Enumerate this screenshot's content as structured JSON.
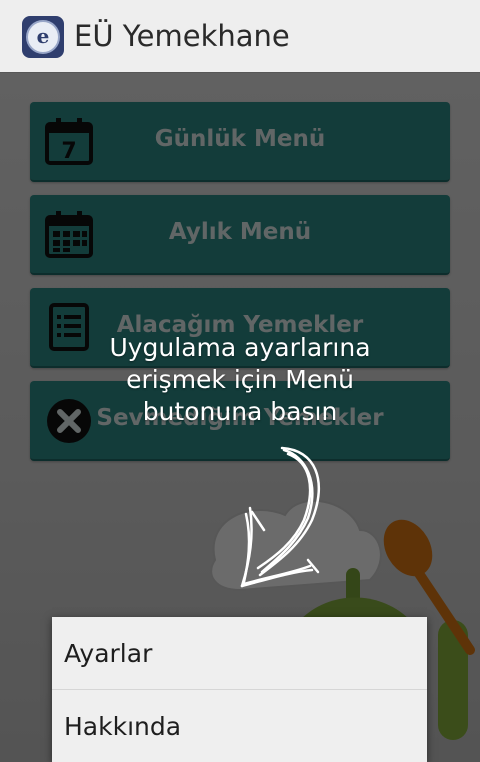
{
  "app": {
    "title": "EÜ Yemekhane",
    "logo_letter": "e"
  },
  "menu_buttons": [
    {
      "label": "Günlük Menü",
      "icon": "calendar-day-icon",
      "day": "7"
    },
    {
      "label": "Aylık Menü",
      "icon": "calendar-month-icon"
    },
    {
      "label": "Alacağım Yemekler",
      "icon": "list-icon"
    },
    {
      "label": "Sevmediğim Yemekler",
      "icon": "close-circle-icon"
    }
  ],
  "hint": {
    "lines": [
      "Uygulama ayarlarına",
      "erişmek için Menü",
      "butonuna basın"
    ],
    "arrow_icon": "hand-drawn-arrow-icon"
  },
  "options_menu": {
    "items": [
      {
        "label": "Ayarlar"
      },
      {
        "label": "Hakkında"
      }
    ]
  },
  "colors": {
    "button": "#2f8f8a",
    "actionbar": "#eeeeee",
    "overlay": "rgba(0,0,0,0.58)"
  }
}
